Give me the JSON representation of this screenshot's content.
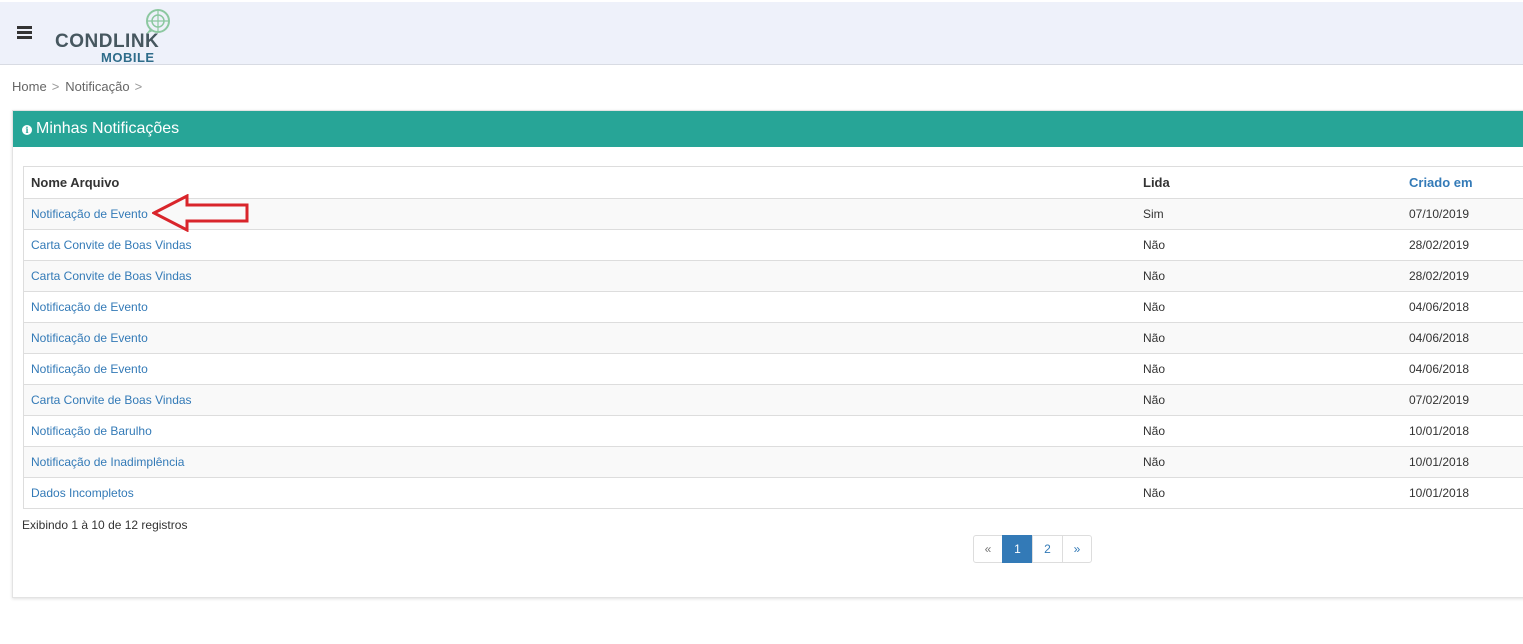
{
  "header": {
    "logo_main": "CONDLINK",
    "logo_sub": "MOBILE"
  },
  "breadcrumb": {
    "items": [
      "Home",
      "Notificação"
    ],
    "separator": ">"
  },
  "panel": {
    "title": "Minhas Notificações"
  },
  "table": {
    "columns": [
      "Nome Arquivo",
      "Lida",
      "Criado em"
    ],
    "rows": [
      {
        "name": "Notificação de Evento",
        "lida": "Sim",
        "criado": "07/10/2019"
      },
      {
        "name": "Carta Convite de Boas Vindas",
        "lida": "Não",
        "criado": "28/02/2019"
      },
      {
        "name": "Carta Convite de Boas Vindas",
        "lida": "Não",
        "criado": "28/02/2019"
      },
      {
        "name": "Notificação de Evento",
        "lida": "Não",
        "criado": "04/06/2018"
      },
      {
        "name": "Notificação de Evento",
        "lida": "Não",
        "criado": "04/06/2018"
      },
      {
        "name": "Notificação de Evento",
        "lida": "Não",
        "criado": "04/06/2018"
      },
      {
        "name": "Carta Convite de Boas Vindas",
        "lida": "Não",
        "criado": "07/02/2019"
      },
      {
        "name": "Notificação de Barulho",
        "lida": "Não",
        "criado": "10/01/2018"
      },
      {
        "name": "Notificação de Inadimplência",
        "lida": "Não",
        "criado": "10/01/2018"
      },
      {
        "name": "Dados Incompletos",
        "lida": "Não",
        "criado": "10/01/2018"
      }
    ]
  },
  "footer": {
    "info": "Exibindo 1 à 10 de 12 registros",
    "pagination": {
      "prev": "«",
      "pages": [
        "1",
        "2"
      ],
      "active": "1",
      "next": "»"
    }
  },
  "colors": {
    "panel_header": "#27a597",
    "link": "#337ab7",
    "annotation_arrow": "#d9252b"
  },
  "icons": {
    "menu": "hamburger-icon",
    "panel_info": "info-circle-icon",
    "annotation": "red-arrow-annotation"
  }
}
